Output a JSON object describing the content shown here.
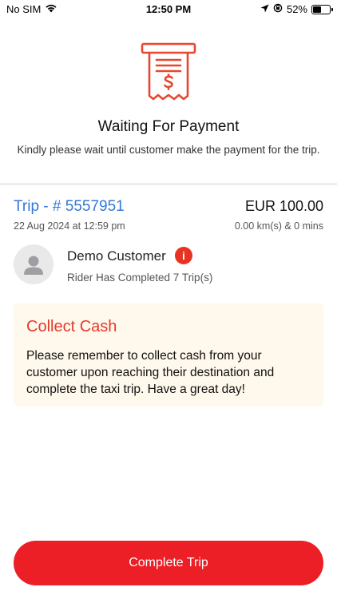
{
  "status_bar": {
    "carrier": "No SIM",
    "time": "12:50 PM",
    "battery_percent": "52%",
    "battery_level": 0.52,
    "icons": [
      "wifi-icon",
      "location-arrow-icon",
      "orientation-lock-icon",
      "battery-icon"
    ]
  },
  "header": {
    "icon": "receipt-dollar-icon",
    "title": "Waiting For Payment",
    "subtitle": "Kindly please wait until customer make the payment for the trip."
  },
  "trip": {
    "id_label": "Trip - # 5557951",
    "amount": "EUR 100.00",
    "date": "22 Aug 2024 at 12:59 pm",
    "distance_time": "0.00 km(s) & 0 mins"
  },
  "customer": {
    "name": "Demo Customer",
    "trips_text": "Rider Has Completed 7 Trip(s)",
    "info_icon_glyph": "i"
  },
  "cash_notice": {
    "title": "Collect Cash",
    "message": "Please remember to collect cash from your customer upon reaching their destination and complete the taxi trip. Have a great day!"
  },
  "actions": {
    "complete_label": "Complete Trip"
  },
  "colors": {
    "accent_red": "#ec1f26",
    "link_blue": "#3478d6",
    "notice_bg": "#fff8ec",
    "notice_title": "#e23b2c"
  }
}
